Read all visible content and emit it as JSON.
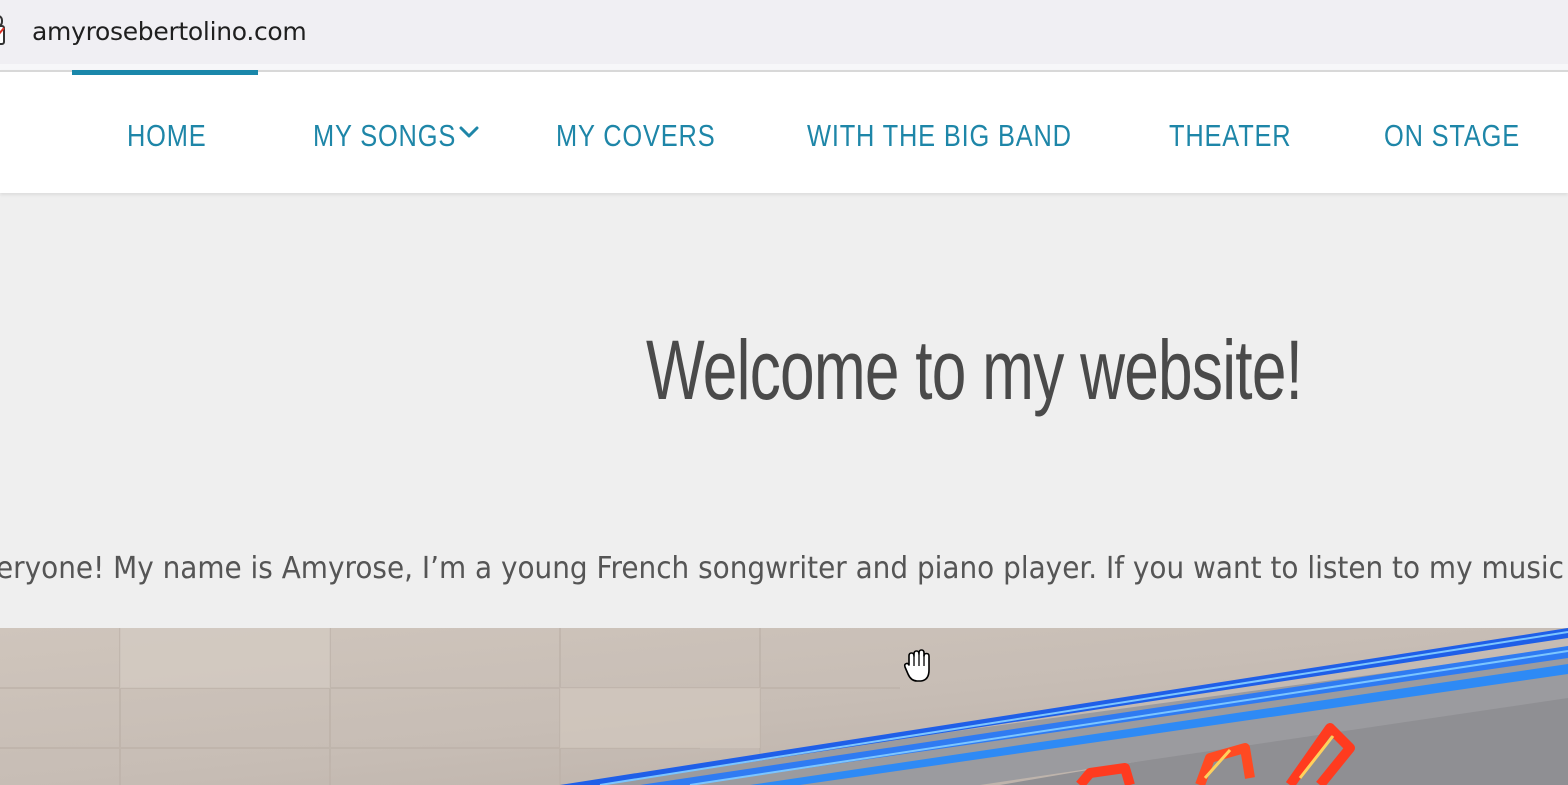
{
  "browser": {
    "url": "amyrosebertolino.com",
    "icons": [
      "lock-icon"
    ]
  },
  "nav": {
    "items": [
      {
        "label": "HOME",
        "active": true
      },
      {
        "label": "MY SONGS",
        "has_dropdown": true
      },
      {
        "label": "MY COVERS"
      },
      {
        "label": "WITH THE BIG BAND"
      },
      {
        "label": "THEATER"
      },
      {
        "label": "ON STAGE"
      }
    ],
    "accent_color": "#1e86a8"
  },
  "main": {
    "title": "Welcome to my website!",
    "intro": "eryone! My name is Amyrose, I’m a young French songwriter and piano player. If you want to listen to my music"
  },
  "banner": {
    "icons": [
      "hand-cursor-icon"
    ]
  }
}
